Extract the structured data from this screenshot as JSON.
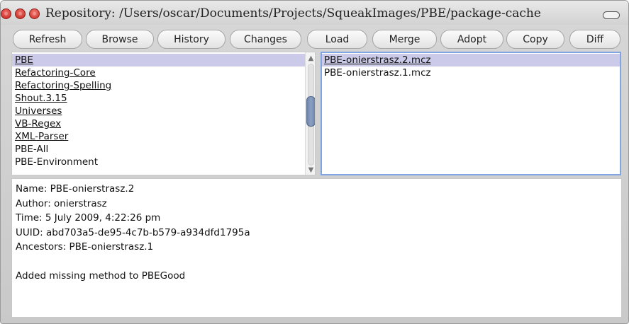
{
  "window": {
    "title": "Repository: /Users/oscar/Documents/Projects/SqueakImages/PBE/package-cache"
  },
  "toolbar": {
    "buttons": [
      {
        "label": "Refresh"
      },
      {
        "label": "Browse"
      },
      {
        "label": "History"
      },
      {
        "label": "Changes"
      },
      {
        "label": "Load"
      },
      {
        "label": "Merge"
      },
      {
        "label": "Adopt"
      },
      {
        "label": "Copy"
      },
      {
        "label": "Diff"
      }
    ]
  },
  "packages": {
    "items": [
      {
        "label": "PBE",
        "underlined": true,
        "selected": true
      },
      {
        "label": "Refactoring-Core",
        "underlined": true,
        "selected": false
      },
      {
        "label": "Refactoring-Spelling",
        "underlined": true,
        "selected": false
      },
      {
        "label": "Shout.3.15",
        "underlined": true,
        "selected": false
      },
      {
        "label": "Universes",
        "underlined": true,
        "selected": false
      },
      {
        "label": "VB-Regex",
        "underlined": true,
        "selected": false
      },
      {
        "label": "XML-Parser",
        "underlined": true,
        "selected": false
      },
      {
        "label": "PBE-All",
        "underlined": false,
        "selected": false
      },
      {
        "label": "PBE-Environment",
        "underlined": false,
        "selected": false
      }
    ]
  },
  "versions": {
    "items": [
      {
        "label": "PBE-onierstrasz.2.mcz",
        "underlined": true,
        "selected": true
      },
      {
        "label": "PBE-onierstrasz.1.mcz",
        "underlined": false,
        "selected": false
      }
    ]
  },
  "details": {
    "name": "Name: PBE-onierstrasz.2",
    "author": "Author: onierstrasz",
    "time": "Time: 5 July 2009, 4:22:26 pm",
    "uuid": "UUID: abd703a5-de95-4c7b-b579-a934dfd1795a",
    "ancestors": "Ancestors: PBE-onierstrasz.1",
    "message": "Added missing method to PBEGood"
  },
  "icons": {
    "close": "close-icon",
    "minimize": "minimize-icon",
    "maximize": "maximize-icon",
    "collapse": "collapse-icon",
    "scroll_up": "chevron-up-icon",
    "scroll_down": "chevron-down-icon"
  },
  "colors": {
    "selection": "#cbcbe9",
    "focus_border": "#7fa6e3",
    "scroll_thumb": "#7a8fb3"
  }
}
